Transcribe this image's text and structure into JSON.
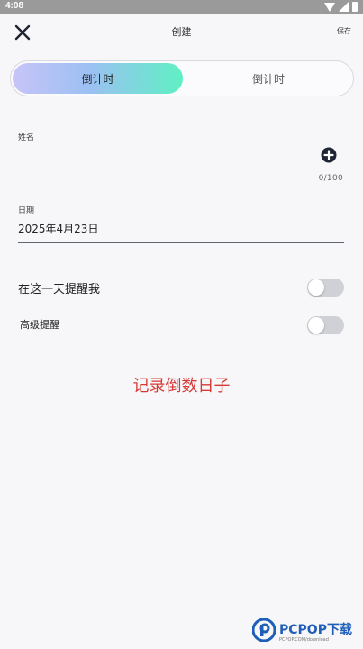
{
  "status_bar": {
    "time": "4:08"
  },
  "header": {
    "title": "创建",
    "save_label": "保存"
  },
  "segments": {
    "active": "倒计时",
    "inactive": "倒计时"
  },
  "name_field": {
    "label": "姓名",
    "value": "",
    "counter": "0/100"
  },
  "date_field": {
    "label": "日期",
    "value": "2025年4月23日"
  },
  "reminders": [
    {
      "label": "在这一天提醒我",
      "enabled": false
    },
    {
      "label": "高级提醒",
      "enabled": false
    }
  ],
  "caption": "记录倒数日子",
  "watermark": {
    "brand": "PCPOP下载",
    "sub": "PCPOP.COM/download"
  },
  "colors": {
    "caption": "#d63a34",
    "gradient_start": "#c7c4f8",
    "gradient_end": "#5ff0c4",
    "toggle_off": "#cfd1d6"
  },
  "icons": {
    "close": "close-icon",
    "add": "plus-circle-icon",
    "wifi": "wifi-icon",
    "signal": "signal-icon",
    "battery": "battery-icon"
  }
}
